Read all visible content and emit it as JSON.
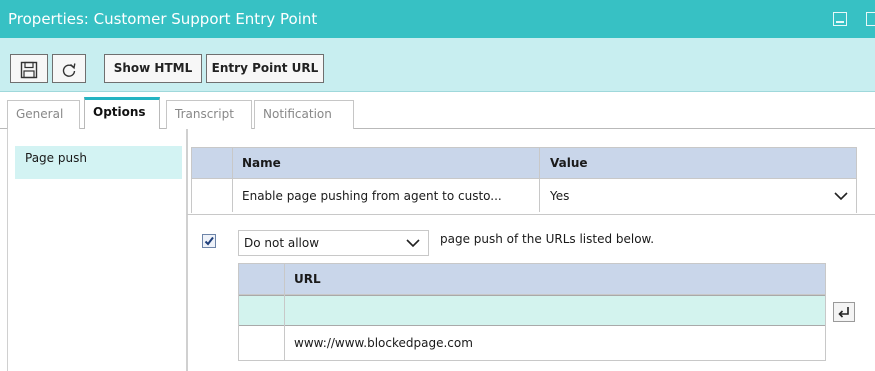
{
  "window": {
    "title": "Properties: Customer Support Entry Point"
  },
  "toolbar": {
    "save_icon": "save-icon",
    "refresh_icon": "refresh-icon",
    "show_html_label": "Show HTML",
    "entry_point_url_label": "Entry Point URL"
  },
  "tabs": [
    {
      "label": "General",
      "active": false
    },
    {
      "label": "Options",
      "active": true
    },
    {
      "label": "Transcript",
      "active": false
    },
    {
      "label": "Notification",
      "active": false
    }
  ],
  "left_panel": {
    "items": [
      {
        "label": "Page push",
        "selected": true
      }
    ]
  },
  "properties_table": {
    "columns": [
      "Name",
      "Value"
    ],
    "rows": [
      {
        "name": "Enable page pushing from agent to custo...",
        "value": "Yes"
      }
    ]
  },
  "url_policy": {
    "checked": true,
    "mode_value": "Do not allow",
    "after_text": "page push of the URLs listed below."
  },
  "url_table": {
    "columns": [
      "URL"
    ],
    "new_row_value": "",
    "rows": [
      {
        "url": "www://www.blockedpage.com"
      }
    ]
  },
  "colors": {
    "titlebar": "#37c1c4",
    "toolbar": "#c8eef0",
    "table_header": "#c9d6ea",
    "selection": "#d3f3f3",
    "active_tab_accent": "#25b4c2"
  }
}
